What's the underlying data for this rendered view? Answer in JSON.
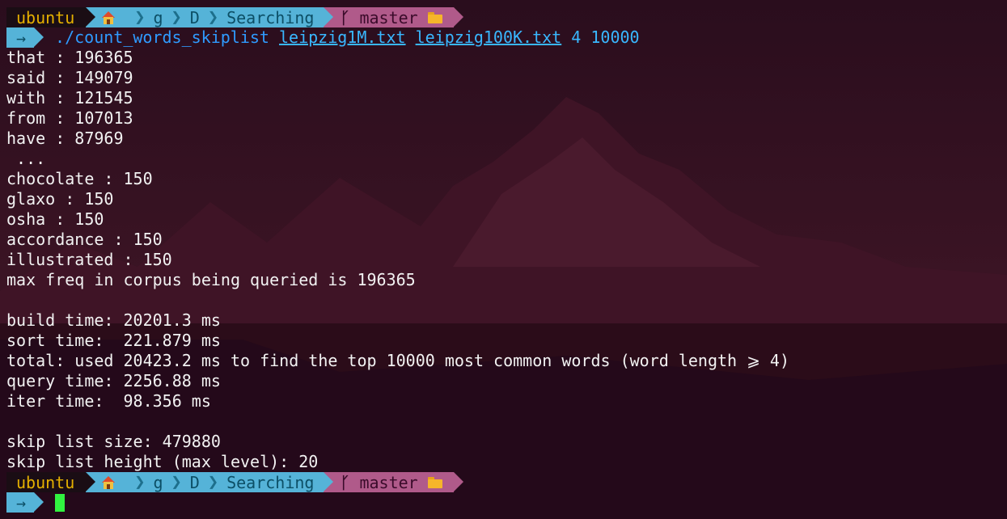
{
  "prompt": {
    "user": "ubuntu",
    "path_icon": "home-icon",
    "path": [
      "g",
      "D",
      "Searching"
    ],
    "branch_icon": "git-branch-icon",
    "branch": "master",
    "folder_icon": "folder-icon",
    "arrow": "→"
  },
  "command": {
    "program": "./count_words_skiplist",
    "arg1": "leipzig1M.txt",
    "arg2": "leipzig100K.txt",
    "arg3": "4",
    "arg4": "10000"
  },
  "output": [
    "that : 196365",
    "said : 149079",
    "with : 121545",
    "from : 107013",
    "have : 87969",
    " ...",
    "chocolate : 150",
    "glaxo : 150",
    "osha : 150",
    "accordance : 150",
    "illustrated : 150",
    "max freq in corpus being queried is 196365",
    "",
    "build time: 20201.3 ms",
    "sort time:  221.879 ms",
    "total: used 20423.2 ms to find the top 10000 most common words (word length ⩾ 4)",
    "query time: 2256.88 ms",
    "iter time:  98.356 ms",
    "",
    "skip list size: 479880",
    "skip list height (max level): 20"
  ],
  "colors": {
    "background": "#2e0f1f",
    "prompt_user_bg": "#1a0d14",
    "prompt_user_fg": "#e5b000",
    "prompt_path_bg": "#55b3d8",
    "prompt_git_bg": "#b05a8a",
    "command": "#2f9bff",
    "cursor": "#31f240"
  }
}
